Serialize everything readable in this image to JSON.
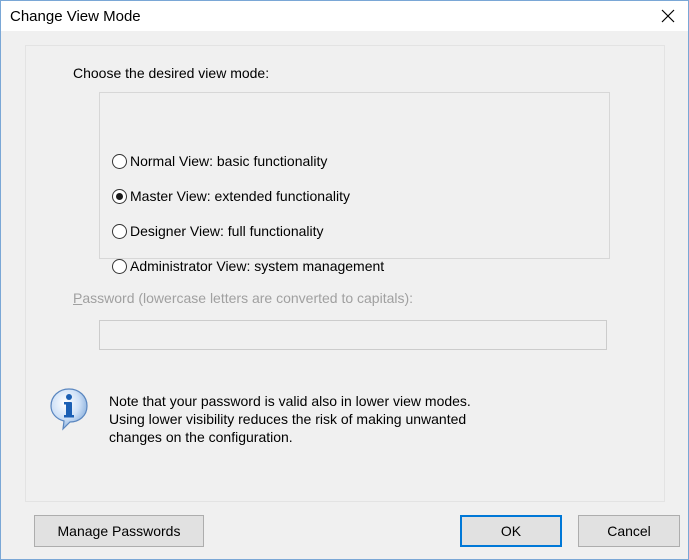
{
  "window": {
    "title": "Change View Mode",
    "close_glyph": "✕"
  },
  "prompt": "Choose the desired view mode:",
  "view_modes": [
    {
      "label": "Normal View:  basic functionality",
      "checked": false
    },
    {
      "label": "Master View:  extended functionality",
      "checked": true
    },
    {
      "label": "Designer View:  full functionality",
      "checked": false
    },
    {
      "label": "Administrator View:  system management",
      "checked": false
    }
  ],
  "password": {
    "label_mnemonic": "P",
    "label_rest": "assword (lowercase letters are converted to capitals):",
    "value": "",
    "enabled": false
  },
  "note": {
    "icon": "info-icon",
    "lines": [
      "Note that your password is valid also in lower view modes.",
      "Using lower visibility reduces the risk of making unwanted",
      "changes on the configuration."
    ]
  },
  "buttons": {
    "manage_passwords": "Manage Passwords",
    "ok": "OK",
    "cancel": "Cancel"
  },
  "colors": {
    "window_border": "#7aa7d6",
    "dialog_bg": "#f0f0f0",
    "default_button_border": "#0078d7",
    "disabled_text": "#a0a0a0",
    "info_icon": "#1a5fb4"
  }
}
